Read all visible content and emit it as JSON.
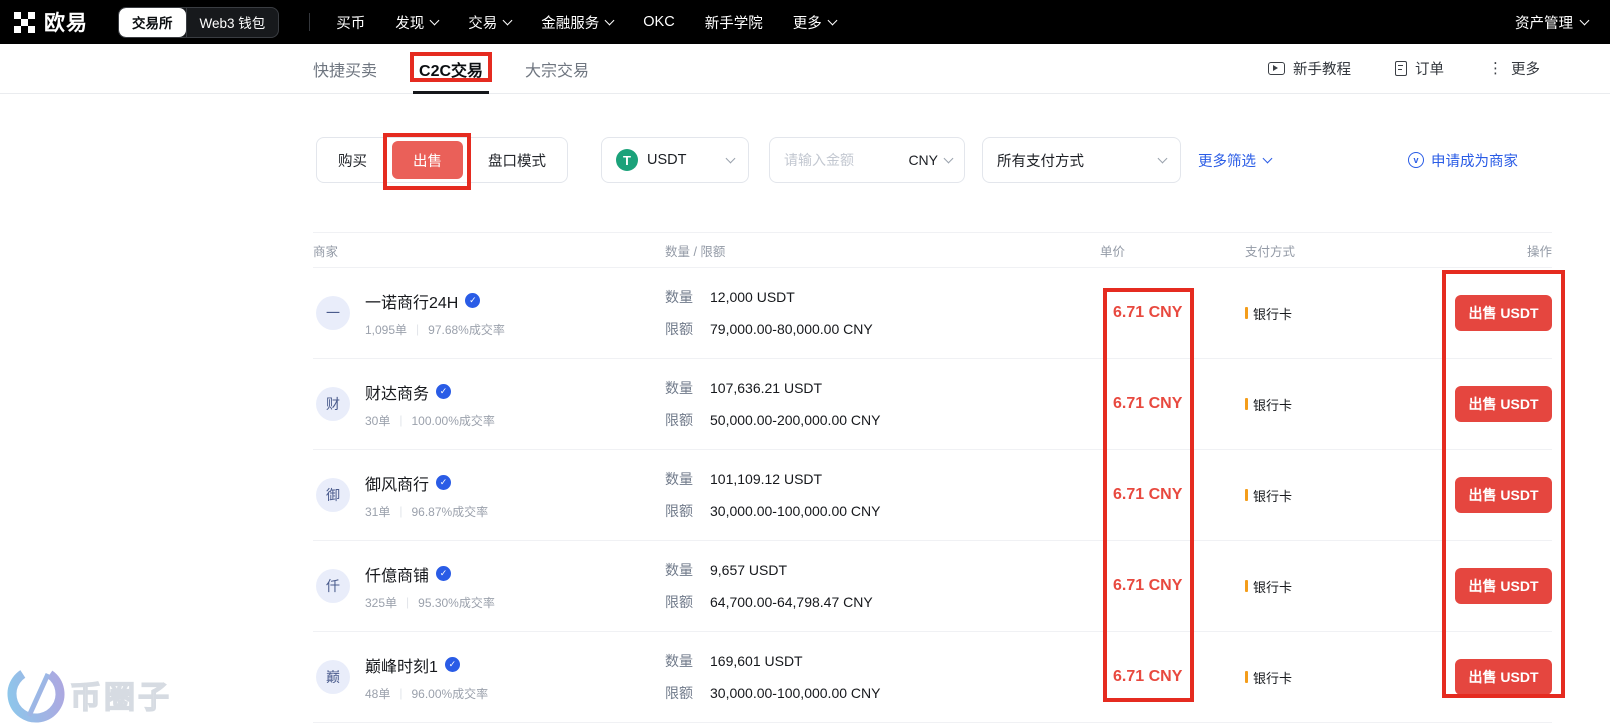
{
  "navbar": {
    "brand": "欧易",
    "toggle": {
      "exchange": "交易所",
      "web3": "Web3 钱包"
    },
    "items": [
      {
        "label": "买币"
      },
      {
        "label": "发现"
      },
      {
        "label": "交易"
      },
      {
        "label": "金融服务"
      },
      {
        "label": "OKC"
      },
      {
        "label": "新手学院"
      },
      {
        "label": "更多"
      }
    ],
    "right": {
      "label": "资产管理"
    }
  },
  "subnav": {
    "tabs": [
      {
        "label": "快捷买卖"
      },
      {
        "label": "C2C交易"
      },
      {
        "label": "大宗交易"
      }
    ],
    "actions": [
      {
        "label": "新手教程"
      },
      {
        "label": "订单"
      },
      {
        "label": "更多"
      }
    ]
  },
  "filters": {
    "side_tabs": {
      "buy": "购买",
      "sell": "出售",
      "orderbook": "盘口模式"
    },
    "crypto_select": {
      "value": "USDT",
      "icon_letter": "T"
    },
    "amount_input": {
      "placeholder": "请输入金额",
      "currency": "CNY"
    },
    "payment_select": {
      "value": "所有支付方式"
    },
    "more_filters": "更多筛选",
    "become_merchant": "申请成为商家",
    "shield_glyph": "v"
  },
  "table": {
    "headers": {
      "merchant": "商家",
      "amount_limit": "数量 / 限额",
      "price": "单价",
      "payment": "支付方式",
      "action": "操作"
    },
    "labels": {
      "amount": "数量",
      "limit": "限额",
      "stats_sep": "|"
    },
    "action_label": "出售 USDT",
    "verified_glyph": "✓",
    "rows": [
      {
        "avatar": "一",
        "name": "一诺商行24H",
        "orders": "1,095单",
        "rate": "97.68%成交率",
        "amount": "12,000 USDT",
        "limit": "79,000.00-80,000.00 CNY",
        "price": "6.71 CNY",
        "payment": "银行卡"
      },
      {
        "avatar": "财",
        "name": "财达商务",
        "orders": "30单",
        "rate": "100.00%成交率",
        "amount": "107,636.21 USDT",
        "limit": "50,000.00-200,000.00 CNY",
        "price": "6.71 CNY",
        "payment": "银行卡"
      },
      {
        "avatar": "御",
        "name": "御风商行",
        "orders": "31单",
        "rate": "96.87%成交率",
        "amount": "101,109.12 USDT",
        "limit": "30,000.00-100,000.00 CNY",
        "price": "6.71 CNY",
        "payment": "银行卡"
      },
      {
        "avatar": "仟",
        "name": "仟億商铺",
        "orders": "325单",
        "rate": "95.30%成交率",
        "amount": "9,657 USDT",
        "limit": "64,700.00-64,798.47 CNY",
        "price": "6.71 CNY",
        "payment": "银行卡"
      },
      {
        "avatar": "巅",
        "name": "巅峰时刻1",
        "orders": "48单",
        "rate": "96.00%成交率",
        "amount": "169,601 USDT",
        "limit": "30,000.00-100,000.00 CNY",
        "price": "6.71 CNY",
        "payment": "银行卡"
      }
    ]
  },
  "watermark": "币圈子",
  "colors": {
    "brand_red": "#e5463f",
    "annotation_red": "#e52b20",
    "link_blue": "#2a5ce6",
    "tether_green": "#1ba27a",
    "price_red": "#e8493f"
  }
}
